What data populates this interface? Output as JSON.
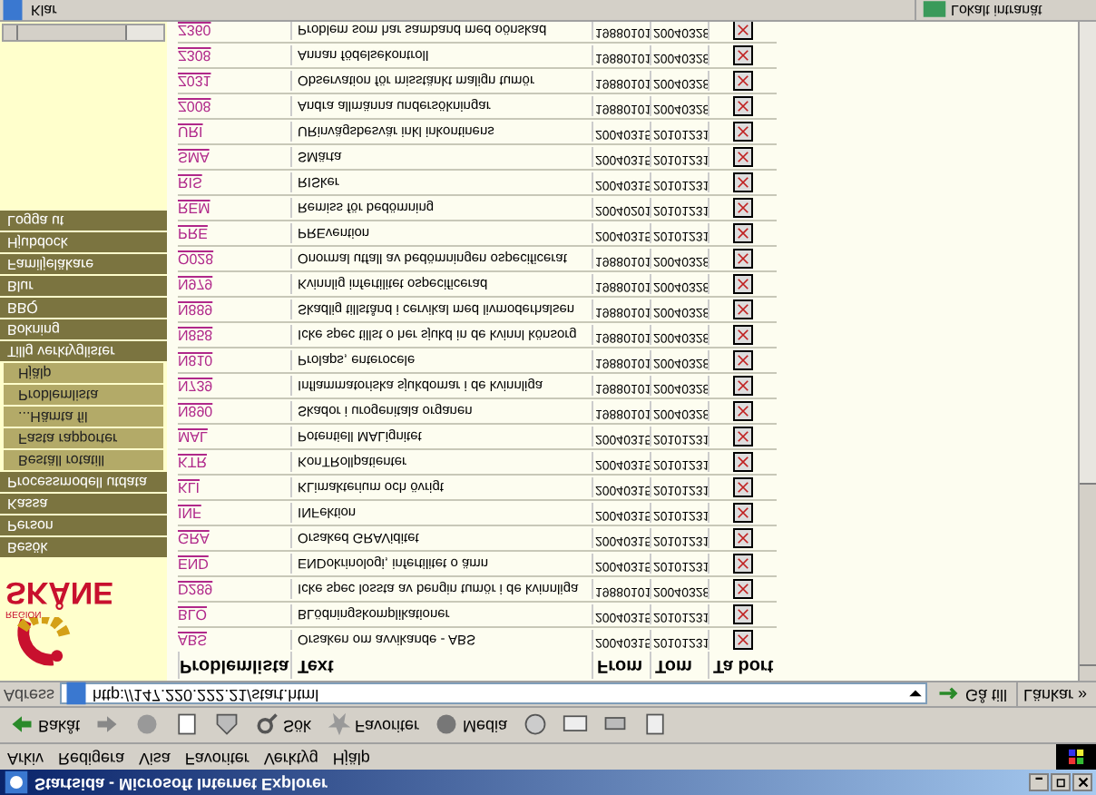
{
  "window": {
    "title": "Startsida - Microsoft Internet Explorer"
  },
  "menu": [
    "Arkiv",
    "Redigera",
    "Visa",
    "Favoriter",
    "Verktyg",
    "Hjälp"
  ],
  "toolbar": {
    "back": "Bakåt",
    "search": "Sök",
    "favorites": "Favoriter",
    "media": "Media"
  },
  "address": {
    "label": "Adress",
    "value": "http://147.220.222.21/start.html",
    "go": "Gå till",
    "links": "Länkar »"
  },
  "logo": {
    "region": "REGION",
    "name": "SKÅNE"
  },
  "sidebar": {
    "items": [
      {
        "label": "Logga ut",
        "kind": "main"
      },
      {
        "label": "Hjubdock",
        "kind": "main"
      },
      {
        "label": "Familjeläkare",
        "kind": "main"
      },
      {
        "label": "Blur",
        "kind": "main"
      },
      {
        "label": "BBQ",
        "kind": "main"
      },
      {
        "label": "Bokning",
        "kind": "main"
      },
      {
        "label": "Tillg verktyglister",
        "kind": "main"
      },
      {
        "label": "Hjälp",
        "kind": "sub"
      },
      {
        "label": "Problemlista",
        "kind": "sub"
      },
      {
        "label": "...Hämta fil",
        "kind": "sub"
      },
      {
        "label": "Fasta rapporter",
        "kind": "sub"
      },
      {
        "label": "Beställ rotatill",
        "kind": "sub"
      },
      {
        "label": "Processmodell utdata",
        "kind": "main"
      },
      {
        "label": "Kassa",
        "kind": "main"
      },
      {
        "label": "Person",
        "kind": "main"
      },
      {
        "label": "Besök",
        "kind": "main"
      }
    ]
  },
  "table": {
    "rows": [
      {
        "code": "Z360",
        "text": "Problem som har samband med oönskad",
        "from": "19880101",
        "tom": "20040328"
      },
      {
        "code": "Z308",
        "text": "Annan födelsekontroll",
        "from": "19880101",
        "tom": "20040328"
      },
      {
        "code": "Z031",
        "text": "Observation för misstänkt malign tumör",
        "from": "19880101",
        "tom": "20040328"
      },
      {
        "code": "Z008",
        "text": "Andra allmänna undersökningar",
        "from": "19880101",
        "tom": "20040328"
      },
      {
        "code": "URI",
        "text": "URinvägsbesvär inkl inkontinens",
        "from": "20040315",
        "tom": "20101231"
      },
      {
        "code": "SMA",
        "text": "SMärta",
        "from": "20040315",
        "tom": "20101231"
      },
      {
        "code": "RIS",
        "text": "RISker",
        "from": "20040315",
        "tom": "20101231"
      },
      {
        "code": "REM",
        "text": "Remiss för bedömning",
        "from": "20040201",
        "tom": "20101231"
      },
      {
        "code": "PRE",
        "text": "PREvention",
        "from": "20040315",
        "tom": "20101231"
      },
      {
        "code": "O028",
        "text": "Onormal utfall av bedömningen ospecificerat",
        "from": "19880101",
        "tom": "20040328"
      },
      {
        "code": "N979",
        "text": "Kvinnlig infertilitet ospecificerad",
        "from": "19880101",
        "tom": "20040328"
      },
      {
        "code": "N889",
        "text": "Skadlig tillstånd i cervikal med livmoderhalsen",
        "from": "19880101",
        "tom": "20040328"
      },
      {
        "code": "N858",
        "text": "Icke spec tillst o her sjukd in de kvinnl könsorg",
        "from": "19880101",
        "tom": "20040328"
      },
      {
        "code": "N810",
        "text": "Prolaps, enterocele",
        "from": "19880101",
        "tom": "20040328"
      },
      {
        "code": "N739",
        "text": "Inflammatoriska sjukdomar i de kvinnliga",
        "from": "19880101",
        "tom": "20040328"
      },
      {
        "code": "N890",
        "text": "Skador i urogenitala organen",
        "from": "19880101",
        "tom": "20040328"
      },
      {
        "code": "MAL",
        "text": "Potentiell MALignitet",
        "from": "20040315",
        "tom": "20101231"
      },
      {
        "code": "KTR",
        "text": "KonTRollpatienter",
        "from": "20040315",
        "tom": "20101231"
      },
      {
        "code": "KLI",
        "text": "KLimakterium och övrigt",
        "from": "20040315",
        "tom": "20101231"
      },
      {
        "code": "INF",
        "text": "INFektion",
        "from": "20040315",
        "tom": "20101231"
      },
      {
        "code": "GRA",
        "text": "Orsaked GRAViditet",
        "from": "20040315",
        "tom": "20101231"
      },
      {
        "code": "END",
        "text": "ENDokrinologi, infertilitet o ämn",
        "from": "20040315",
        "tom": "20101231"
      },
      {
        "code": "D289",
        "text": "Icke spec lossta av bengin tumör i de kvinnliga",
        "from": "19880101",
        "tom": "20040328"
      },
      {
        "code": "BLO",
        "text": "BLödningskomplikationer",
        "from": "20040315",
        "tom": "20101231"
      },
      {
        "code": "ABS",
        "text": "Orsaken om avvikande - ABS",
        "from": "20040315",
        "tom": "20101231"
      }
    ],
    "columns": [
      "Problemlista",
      "Text",
      "From",
      "Tom",
      "Ta bort"
    ]
  },
  "status_bar": {
    "text": "Klar",
    "zone": "Lokalt intranät"
  }
}
